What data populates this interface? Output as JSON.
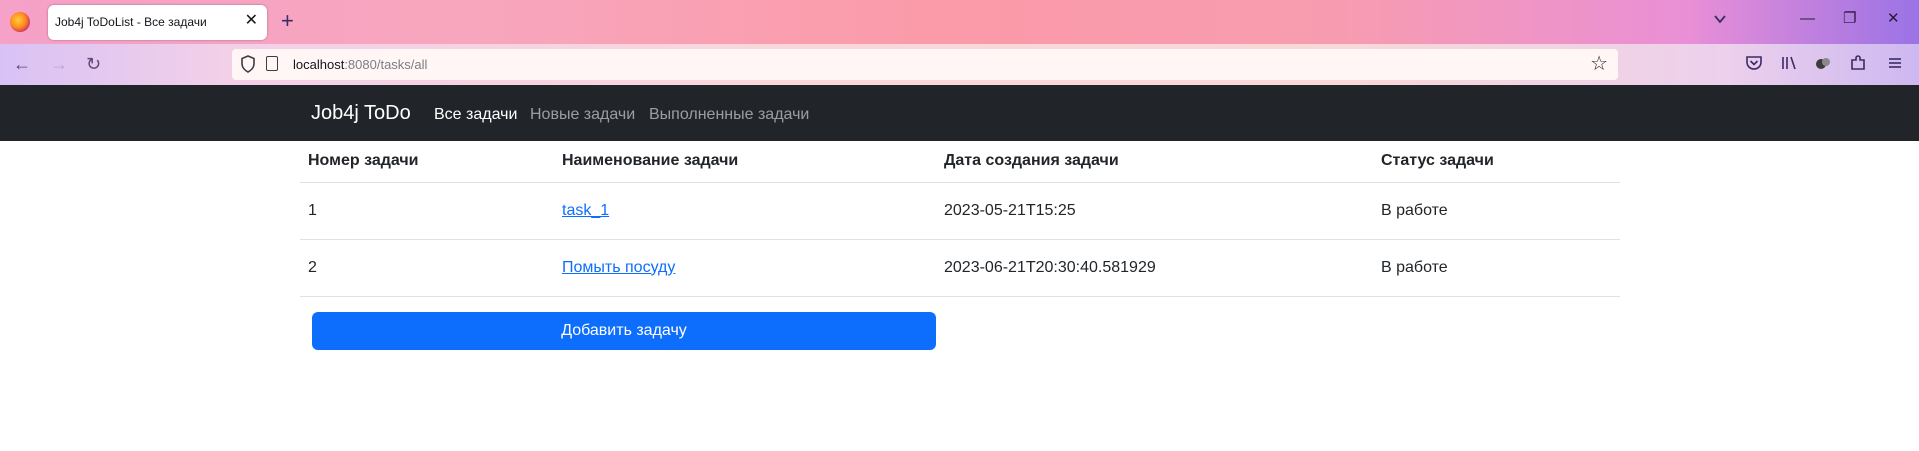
{
  "browser": {
    "tab_title": "Job4j ToDoList - Все задачи",
    "tab_close": "✕",
    "new_tab": "+",
    "url_host": "localhost",
    "url_path": ":8080/tasks/all",
    "win_minimize": "—",
    "win_restore": "❐",
    "win_close": "✕",
    "back": "←",
    "forward": "→",
    "reload": "↻",
    "star": "☆"
  },
  "site": {
    "brand": "Job4j ToDo",
    "nav": [
      {
        "label": "Все задачи",
        "active": true
      },
      {
        "label": "Новые задачи",
        "active": false
      },
      {
        "label": "Выполненные задачи",
        "active": false
      }
    ]
  },
  "table": {
    "headers": [
      "Номер задачи",
      "Наименование задачи",
      "Дата создания задачи",
      "Статус задачи"
    ],
    "rows": [
      {
        "id": "1",
        "name": "task_1",
        "created": "2023-05-21T15:25",
        "status": "В работе"
      },
      {
        "id": "2",
        "name": "Помыть посуду",
        "created": "2023-06-21T20:30:40.581929",
        "status": "В работе"
      }
    ]
  },
  "actions": {
    "add_task": "Добавить задачу"
  },
  "colors": {
    "navbar_bg": "#212529",
    "link": "#0d6efd",
    "primary_button": "#0d6efd"
  }
}
